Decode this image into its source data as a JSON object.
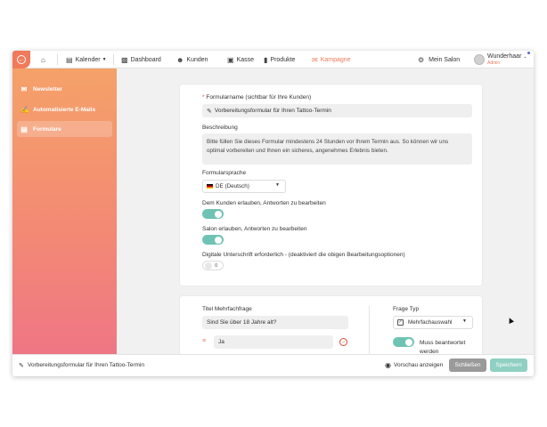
{
  "nav": {
    "calendar": "Kalender",
    "dashboard": "Dashboard",
    "customers": "Kunden",
    "register": "Kasse",
    "products": "Produkte",
    "campaign": "Kampagne",
    "my_salon": "Mein Salon",
    "user_name": "Wunderhaar",
    "user_role": "Admin"
  },
  "sidebar": {
    "items": [
      {
        "label": "Newsletter",
        "icon": "envelope-icon"
      },
      {
        "label": "Automatisierte E-Mails",
        "icon": "auto-email-icon"
      },
      {
        "label": "Formulare",
        "icon": "form-icon"
      }
    ]
  },
  "form": {
    "name_label": "Formularname (sichtbar für Ihre Kunden)",
    "name_value": "Vorbereitungsformular für Ihren Tattoo-Termin",
    "description_label": "Beschreibung",
    "description_value": "Bitte füllen Sie dieses Formular mindestens 24 Stunden vor Ihrem Termin aus. So können wir uns optimal vorbereiten und Ihnen ein sicheres, angenehmes Erlebnis bieten.",
    "language_label": "Formularsprache",
    "language_value": "DE (Deutsch)",
    "toggle1_label": "Dem Kunden erlauben, Antworten zu bearbeiten",
    "toggle2_label": "Salon erlauben, Antworten zu bearbeiten",
    "toggle3_label": "Digitale Unterschrift erforderlich - (deaktiviert die obigen Bearbeitungsoptionen)",
    "toggle3_value": "0"
  },
  "question": {
    "title_label": "Titel Mehrfachfrage",
    "title_value": "Sind Sie über 18 Jahre alt?",
    "option1": "Ja",
    "type_label": "Frage Typ",
    "type_value": "Mehrfachauswahl",
    "required_label": "Muss beantwortet werden"
  },
  "footer": {
    "form_name": "Vorbereitungsformular für Ihren Tattoo-Termin",
    "preview": "Vorschau anzeigen",
    "close": "Schließen",
    "save": "Speichern"
  },
  "colors": {
    "accent": "#f07a5a",
    "toggle_on": "#6fc3b4",
    "save_button": "#8fd0c2",
    "close_button": "#9a9a9a"
  }
}
